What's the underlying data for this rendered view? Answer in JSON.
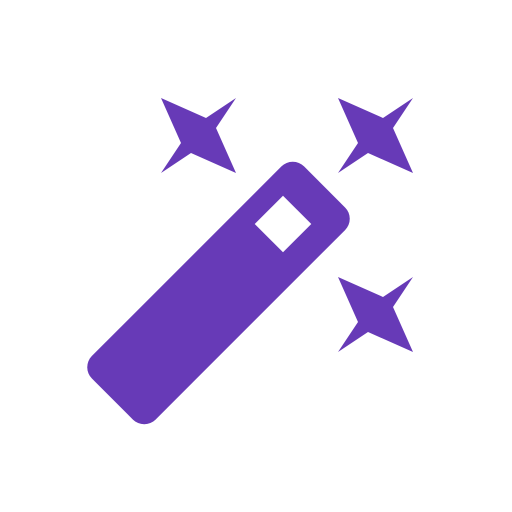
{
  "icon": {
    "name": "magic-wand-icon",
    "color": "#673AB7",
    "background": "#FFFFFF",
    "sparkles": [
      {
        "name": "sparkle-top-left-icon"
      },
      {
        "name": "sparkle-top-right-icon"
      },
      {
        "name": "sparkle-bottom-right-icon"
      }
    ]
  }
}
